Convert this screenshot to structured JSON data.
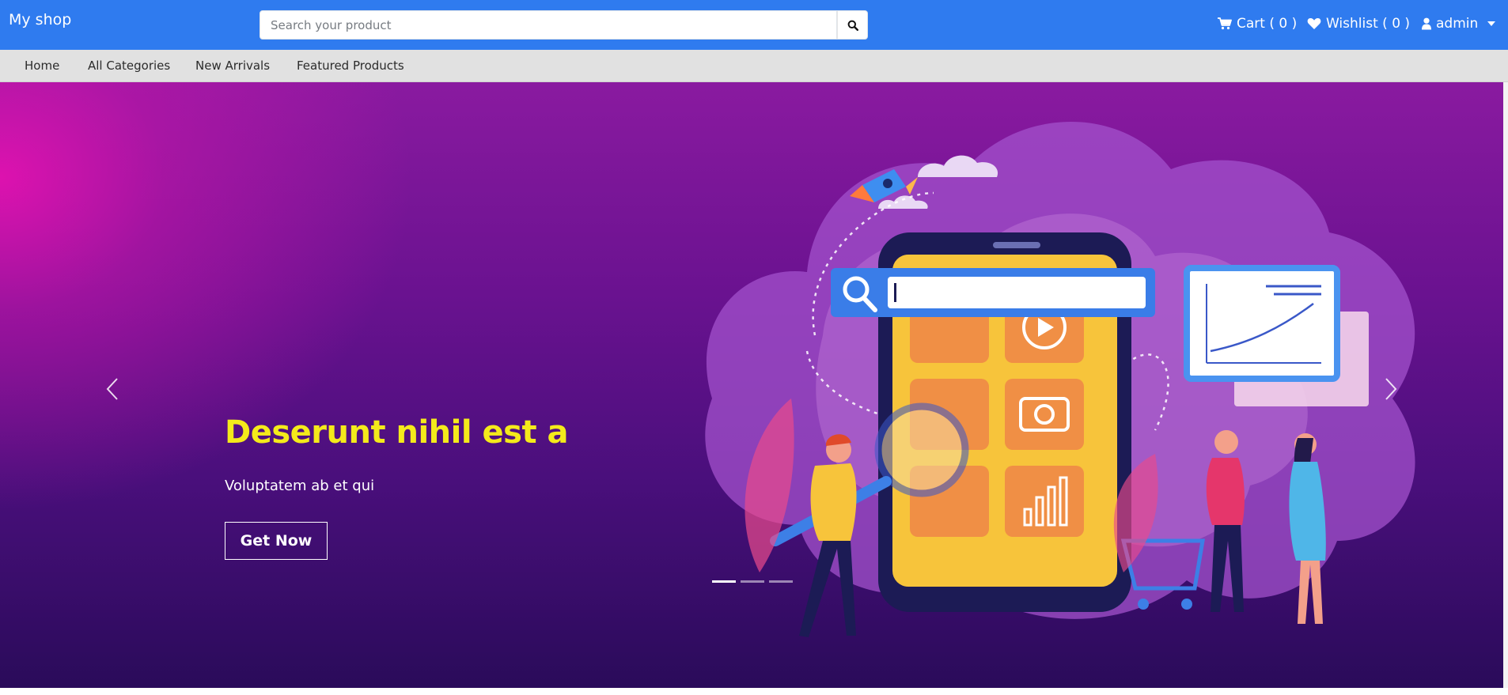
{
  "brand": {
    "name": "My shop"
  },
  "search": {
    "placeholder": "Search your product",
    "value": "",
    "button_icon": "search-icon"
  },
  "nav": {
    "cart_label": "Cart ( 0 )",
    "wishlist_label": "Wishlist ( 0 )",
    "user_label": "admin"
  },
  "categories": [
    {
      "label": "Home"
    },
    {
      "label": "All Categories"
    },
    {
      "label": "New Arrivals"
    },
    {
      "label": "Featured Products"
    }
  ],
  "hero": {
    "title": "Deserunt nihil est a",
    "subtitle": "Voluptatem ab et qui",
    "button_label": "Get Now",
    "slide_count": 3,
    "active_slide": 1
  },
  "colors": {
    "navbar": "#2f7bef",
    "category_bar": "#e1e1e1",
    "hero_title": "#f4ea1b",
    "hero_bg_top": "#8a1aa0",
    "hero_bg_bottom": "#2a0b5a"
  }
}
